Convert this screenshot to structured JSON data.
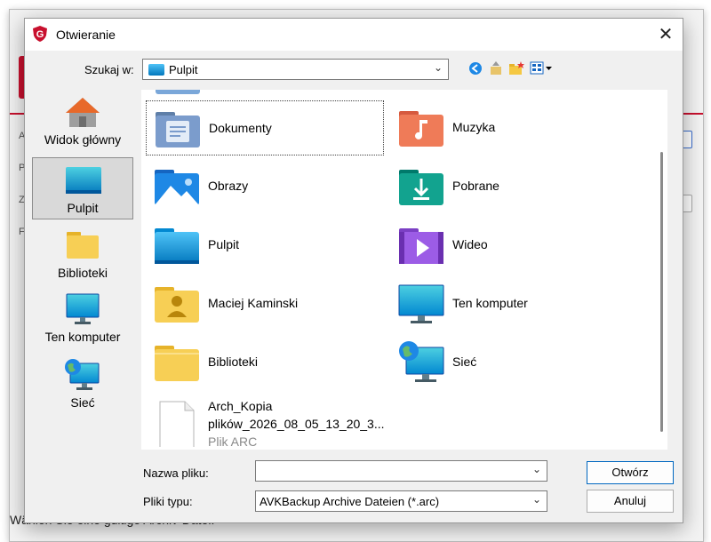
{
  "background": {
    "status_text": "Wählen Sie eine gültige Archiv-Datei.",
    "letters": [
      "A",
      "P",
      "Z",
      "F"
    ]
  },
  "dialog": {
    "title": "Otwieranie",
    "lookin_label": "Szukaj w:",
    "lookin_value": "Pulpit",
    "places": [
      {
        "label": "Widok główny",
        "icon": "home-icon"
      },
      {
        "label": "Pulpit",
        "icon": "desktop-icon",
        "selected": true
      },
      {
        "label": "Biblioteki",
        "icon": "libraries-icon"
      },
      {
        "label": "Ten komputer",
        "icon": "computer-icon"
      },
      {
        "label": "Sieć",
        "icon": "network-icon"
      }
    ],
    "files": [
      {
        "name": "Dokumenty",
        "icon": "documents-folder-icon"
      },
      {
        "name": "Muzyka",
        "icon": "music-folder-icon"
      },
      {
        "name": "Obrazy",
        "icon": "pictures-folder-icon"
      },
      {
        "name": "Pobrane",
        "icon": "downloads-folder-icon"
      },
      {
        "name": "Pulpit",
        "icon": "desktop-folder-icon"
      },
      {
        "name": "Wideo",
        "icon": "videos-folder-icon"
      },
      {
        "name": "Maciej Kaminski",
        "icon": "user-folder-icon"
      },
      {
        "name": "Ten komputer",
        "icon": "computer-icon"
      },
      {
        "name": "Biblioteki",
        "icon": "libraries-folder-icon"
      },
      {
        "name": "Sieć",
        "icon": "network-icon"
      }
    ],
    "archive_file": {
      "name_line1": "Arch_Kopia",
      "name_line2": "plików_2026_08_05_13_20_3...",
      "type": "Plik ARC"
    },
    "filename_label": "Nazwa pliku:",
    "filename_value": "",
    "filetype_label": "Pliki typu:",
    "filetype_value": "AVKBackup Archive Dateien (*.arc)",
    "open_button": "Otwórz",
    "cancel_button": "Anuluj"
  },
  "colors": {
    "accent": "#0067c0",
    "brand_red": "#c8102e"
  }
}
